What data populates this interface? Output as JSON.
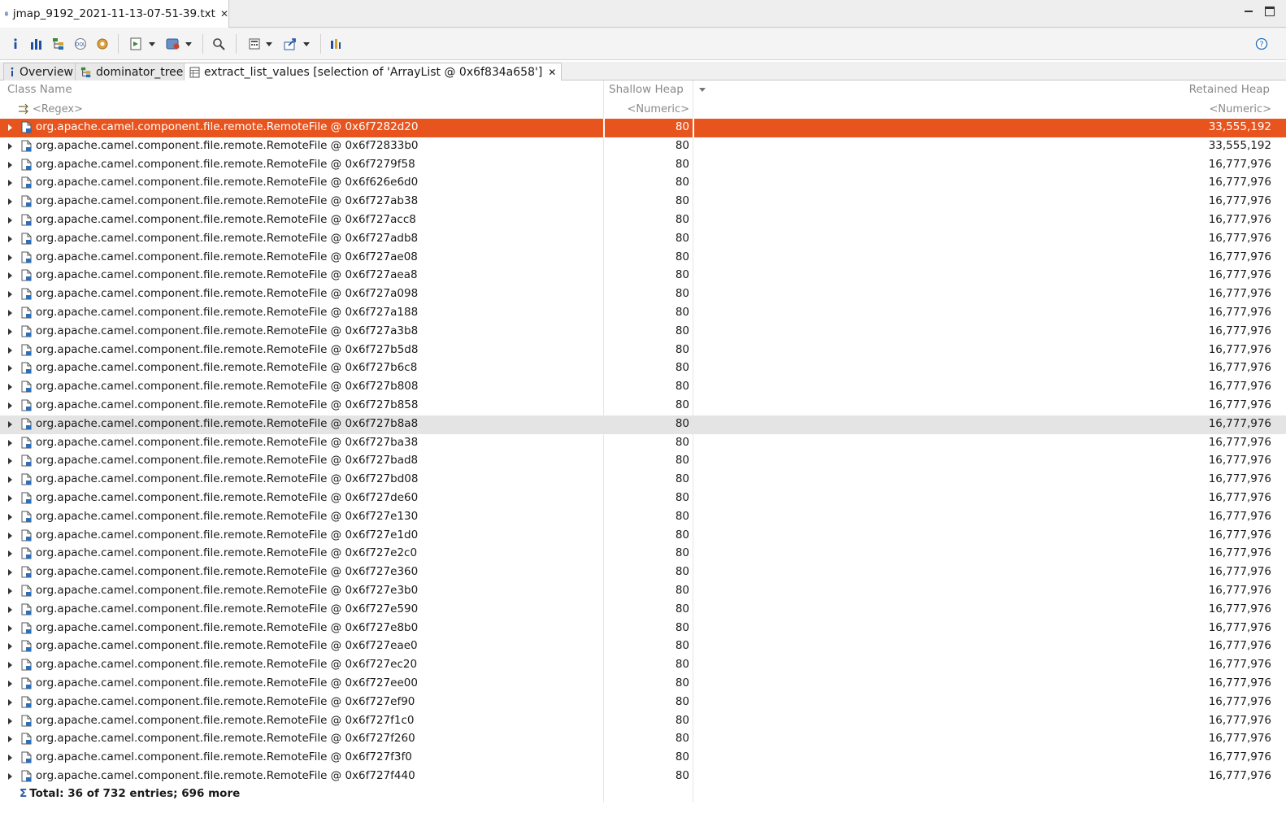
{
  "editor_tab": {
    "title": "jmap_9192_2021-11-13-07-51-39.txt",
    "icon": "heap-dump-icon"
  },
  "toolbar": {
    "icons": [
      "info-icon",
      "histogram-icon",
      "dominator-tree-icon",
      "oql-icon",
      "thread-overview-icon",
      "run-report-icon",
      "query-browser-icon",
      "find-object-icon",
      "calculate-retained-icon",
      "export-icon",
      "group-icon",
      "help-icon"
    ]
  },
  "subtabs": [
    {
      "label": "Overview",
      "icon": "info-icon"
    },
    {
      "label": "dominator_tree",
      "icon": "dominator-tree-icon"
    },
    {
      "label": "extract_list_values  [selection of 'ArrayList @ 0x6f834a658']",
      "icon": "table-icon"
    }
  ],
  "table": {
    "columns": {
      "class_name": "Class Name",
      "shallow_heap": "Shallow Heap",
      "retained_heap": "Retained Heap"
    },
    "filters": {
      "class_name": "<Regex>",
      "shallow_heap": "<Numeric>",
      "retained_heap": "<Numeric>"
    },
    "class_prefix": "org.apache.camel.component.file.remote.RemoteFile @ ",
    "rows": [
      {
        "addr": "0x6f7282d20",
        "shallow": "80",
        "retained": "33,555,192",
        "state": "selected"
      },
      {
        "addr": "0x6f72833b0",
        "shallow": "80",
        "retained": "33,555,192"
      },
      {
        "addr": "0x6f7279f58",
        "shallow": "80",
        "retained": "16,777,976"
      },
      {
        "addr": "0x6f626e6d0",
        "shallow": "80",
        "retained": "16,777,976"
      },
      {
        "addr": "0x6f727ab38",
        "shallow": "80",
        "retained": "16,777,976"
      },
      {
        "addr": "0x6f727acc8",
        "shallow": "80",
        "retained": "16,777,976"
      },
      {
        "addr": "0x6f727adb8",
        "shallow": "80",
        "retained": "16,777,976"
      },
      {
        "addr": "0x6f727ae08",
        "shallow": "80",
        "retained": "16,777,976"
      },
      {
        "addr": "0x6f727aea8",
        "shallow": "80",
        "retained": "16,777,976"
      },
      {
        "addr": "0x6f727a098",
        "shallow": "80",
        "retained": "16,777,976"
      },
      {
        "addr": "0x6f727a188",
        "shallow": "80",
        "retained": "16,777,976"
      },
      {
        "addr": "0x6f727a3b8",
        "shallow": "80",
        "retained": "16,777,976"
      },
      {
        "addr": "0x6f727b5d8",
        "shallow": "80",
        "retained": "16,777,976"
      },
      {
        "addr": "0x6f727b6c8",
        "shallow": "80",
        "retained": "16,777,976"
      },
      {
        "addr": "0x6f727b808",
        "shallow": "80",
        "retained": "16,777,976"
      },
      {
        "addr": "0x6f727b858",
        "shallow": "80",
        "retained": "16,777,976"
      },
      {
        "addr": "0x6f727b8a8",
        "shallow": "80",
        "retained": "16,777,976",
        "state": "hover"
      },
      {
        "addr": "0x6f727ba38",
        "shallow": "80",
        "retained": "16,777,976"
      },
      {
        "addr": "0x6f727bad8",
        "shallow": "80",
        "retained": "16,777,976"
      },
      {
        "addr": "0x6f727bd08",
        "shallow": "80",
        "retained": "16,777,976"
      },
      {
        "addr": "0x6f727de60",
        "shallow": "80",
        "retained": "16,777,976"
      },
      {
        "addr": "0x6f727e130",
        "shallow": "80",
        "retained": "16,777,976"
      },
      {
        "addr": "0x6f727e1d0",
        "shallow": "80",
        "retained": "16,777,976"
      },
      {
        "addr": "0x6f727e2c0",
        "shallow": "80",
        "retained": "16,777,976"
      },
      {
        "addr": "0x6f727e360",
        "shallow": "80",
        "retained": "16,777,976"
      },
      {
        "addr": "0x6f727e3b0",
        "shallow": "80",
        "retained": "16,777,976"
      },
      {
        "addr": "0x6f727e590",
        "shallow": "80",
        "retained": "16,777,976"
      },
      {
        "addr": "0x6f727e8b0",
        "shallow": "80",
        "retained": "16,777,976"
      },
      {
        "addr": "0x6f727eae0",
        "shallow": "80",
        "retained": "16,777,976"
      },
      {
        "addr": "0x6f727ec20",
        "shallow": "80",
        "retained": "16,777,976"
      },
      {
        "addr": "0x6f727ee00",
        "shallow": "80",
        "retained": "16,777,976"
      },
      {
        "addr": "0x6f727ef90",
        "shallow": "80",
        "retained": "16,777,976"
      },
      {
        "addr": "0x6f727f1c0",
        "shallow": "80",
        "retained": "16,777,976"
      },
      {
        "addr": "0x6f727f260",
        "shallow": "80",
        "retained": "16,777,976"
      },
      {
        "addr": "0x6f727f3f0",
        "shallow": "80",
        "retained": "16,777,976"
      },
      {
        "addr": "0x6f727f440",
        "shallow": "80",
        "retained": "16,777,976"
      }
    ],
    "total": "Total: 36 of 732 entries; 696 more"
  },
  "colors": {
    "selection": "#e8541e",
    "hover_row": "#e4e4e4",
    "header_text": "#8a8a8a"
  }
}
